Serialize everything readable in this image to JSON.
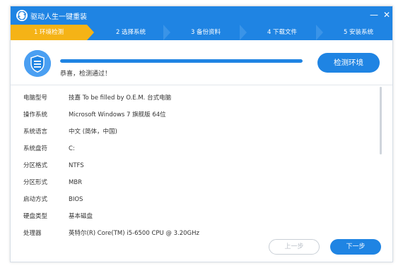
{
  "window": {
    "title": "驱动人生一键重装"
  },
  "steps": [
    {
      "label": "1 环境检测",
      "active": true
    },
    {
      "label": "2 选择系统",
      "active": false
    },
    {
      "label": "3 备份资料",
      "active": false
    },
    {
      "label": "4 下载文件",
      "active": false
    },
    {
      "label": "5 安装系统",
      "active": false
    }
  ],
  "check": {
    "status": "恭喜，检测通过！",
    "button": "检测环境",
    "progress": 1.0
  },
  "info_rows": [
    {
      "key": "电脑型号",
      "value": "技嘉 To be filled by O.E.M. 台式电脑"
    },
    {
      "key": "操作系统",
      "value": "Microsoft Windows 7 旗舰版  64位"
    },
    {
      "key": "系统语言",
      "value": "中文 (简体，中国)"
    },
    {
      "key": "系统盘符",
      "value": "C:"
    },
    {
      "key": "分区格式",
      "value": "NTFS"
    },
    {
      "key": "分区形式",
      "value": "MBR"
    },
    {
      "key": "启动方式",
      "value": "BIOS"
    },
    {
      "key": "硬盘类型",
      "value": "基本磁盘"
    },
    {
      "key": "处理器",
      "value": "英特尔(R) Core(TM) i5-6500 CPU @ 3.20GHz"
    }
  ],
  "nav": {
    "prev": "上一步",
    "next": "下一步"
  },
  "colors": {
    "primary": "#1f84e3",
    "active_step": "#f5b316"
  },
  "icons": {
    "logo": "app-logo-icon",
    "shield": "shield-icon",
    "minimize": "minimize-icon",
    "close": "close-icon"
  }
}
